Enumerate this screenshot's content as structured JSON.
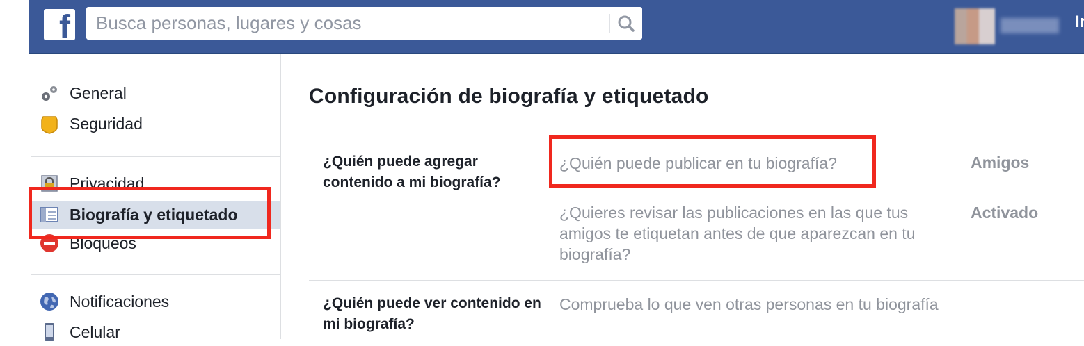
{
  "header": {
    "logo_letter": "f",
    "search_placeholder": "Busca personas, lugares y cosas",
    "user_partial": "Ir",
    "brand_color": "#3b5998"
  },
  "sidebar": {
    "items": [
      {
        "label": "General",
        "icon": "gears-icon"
      },
      {
        "label": "Seguridad",
        "icon": "badge-icon"
      },
      {
        "label": "Privacidad",
        "icon": "lock-icon"
      },
      {
        "label": "Biografía y etiquetado",
        "icon": "timeline-icon",
        "selected": true
      },
      {
        "label": "Bloqueos",
        "icon": "block-icon"
      },
      {
        "label": "Notificaciones",
        "icon": "globe-icon"
      },
      {
        "label": "Celular",
        "icon": "mobile-icon"
      }
    ]
  },
  "main": {
    "title": "Configuración de biografía y etiquetado",
    "sections": [
      {
        "question": "¿Quién puede agregar contenido a mi biografía?",
        "settings": [
          {
            "text": "¿Quién puede publicar en tu biografía?",
            "value": "Amigos"
          },
          {
            "text": "¿Quieres revisar las publicaciones en las que tus amigos te etiquetan antes de que aparezcan en tu biografía?",
            "value": "Activado"
          }
        ]
      },
      {
        "question": "¿Quién puede ver contenido en mi biografía?",
        "settings": [
          {
            "text": "Comprueba lo que ven otras personas en tu biografía",
            "value": ""
          }
        ]
      }
    ]
  },
  "annotation_color": "#f0281e"
}
